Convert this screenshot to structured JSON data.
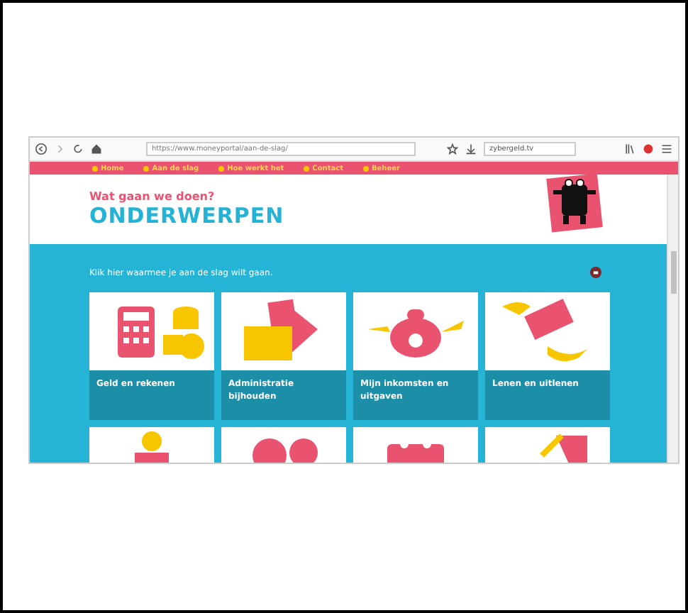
{
  "browser": {
    "url": "https://www.moneyportal/aan-de-slag/",
    "search": {
      "value": "zybergeld.tv"
    }
  },
  "nav": [
    {
      "label": "Home"
    },
    {
      "label": "Aan de slag"
    },
    {
      "label": "Hoe werkt het"
    },
    {
      "label": "Contact"
    },
    {
      "label": "Beheer"
    }
  ],
  "header": {
    "subtitle": "Wat gaan we doen?",
    "title": "ONDERWERPEN"
  },
  "intro": "Klik hier waarmee je aan de slag wilt gaan.",
  "topics": [
    {
      "kind": "calculator",
      "label": "Geld en rekenen"
    },
    {
      "kind": "folder",
      "label": "Administratie bijhouden"
    },
    {
      "kind": "purse",
      "label": "Mijn inkomsten en uitgaven"
    },
    {
      "kind": "lend",
      "label": "Lenen en uitlenen"
    },
    {
      "kind": "coin"
    },
    {
      "kind": "question"
    },
    {
      "kind": "calendar"
    },
    {
      "kind": "tag"
    }
  ]
}
